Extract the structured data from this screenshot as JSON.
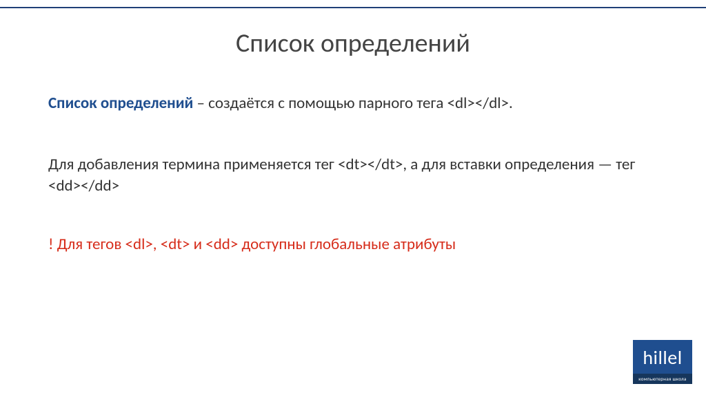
{
  "title": "Список определений",
  "para1": {
    "term": "Список определений",
    "rest": " – создаётся с помощью парного тега <dl></dl>."
  },
  "para2": "Для добавления термина применяется тег <dt></dt>, а для вставки определения — тег <dd></dd>",
  "para3": "! Для тегов <dl>, <dt> и <dd> доступны глобальные атрибуты",
  "logo": {
    "main": "hillel",
    "sub": "компьютерная школа"
  }
}
